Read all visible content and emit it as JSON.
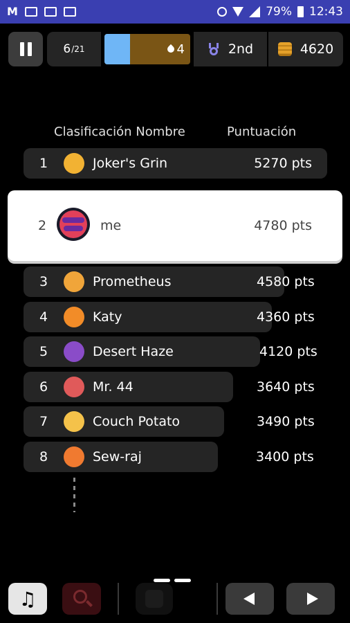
{
  "status_bar": {
    "battery": "79%",
    "time": "12:43"
  },
  "hud": {
    "progress_current": "6",
    "progress_total": "/21",
    "level_bar": {
      "value": "4",
      "fill_fraction": 0.3
    },
    "place": "2nd",
    "coins": "4620"
  },
  "leaderboard": {
    "header_rank_name": "Clasificación Nombre",
    "header_score": "Puntuación",
    "rows": [
      {
        "rank": "1",
        "name": "Joker's Grin",
        "score": "5270 pts",
        "avatar": "joker-avatar-icon",
        "color": "#f2b233"
      },
      {
        "rank": "2",
        "name": "me",
        "score": "4780 pts",
        "avatar": "me-avatar-icon",
        "color": "#e2405a"
      },
      {
        "rank": "3",
        "name": "Prometheus",
        "score": "4580 pts",
        "avatar": "prometheus-avatar-icon",
        "color": "#f0a53a"
      },
      {
        "rank": "4",
        "name": "Katy",
        "score": "4360 pts",
        "avatar": "katy-avatar-icon",
        "color": "#f28c28"
      },
      {
        "rank": "5",
        "name": "Desert Haze",
        "score": "4120 pts",
        "avatar": "desert-haze-avatar-icon",
        "color": "#8a4cc8"
      },
      {
        "rank": "6",
        "name": "Mr. 44",
        "score": "3640 pts",
        "avatar": "mr44-avatar-icon",
        "color": "#e05a5a"
      },
      {
        "rank": "7",
        "name": "Couch Potato",
        "score": "3490 pts",
        "avatar": "couch-potato-avatar-icon",
        "color": "#f5c24a"
      },
      {
        "rank": "8",
        "name": "Sew-raj",
        "score": "3400 pts",
        "avatar": "sew-raj-avatar-icon",
        "color": "#f07a30"
      }
    ]
  }
}
